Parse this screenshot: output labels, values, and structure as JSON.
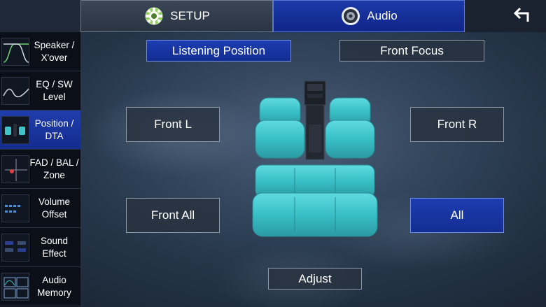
{
  "header": {
    "tabs": [
      {
        "label": "SETUP",
        "icon": "gear-icon",
        "active": false
      },
      {
        "label": "Audio",
        "icon": "speaker-icon",
        "active": true
      }
    ],
    "back_icon": "back-arrow-icon"
  },
  "sidebar": {
    "items": [
      {
        "label": "Speaker /\nX'over",
        "icon": "speaker-xover-thumbnail-icon",
        "active": false
      },
      {
        "label": "EQ / SW\nLevel",
        "icon": "eq-thumbnail-icon",
        "active": false
      },
      {
        "label": "Position /\nDTA",
        "icon": "position-thumbnail-icon",
        "active": true
      },
      {
        "label": "FAD / BAL /\nZone",
        "icon": "fader-balance-thumbnail-icon",
        "active": false
      },
      {
        "label": "Volume\nOffset",
        "icon": "volume-offset-thumbnail-icon",
        "active": false
      },
      {
        "label": "Sound\nEffect",
        "icon": "sound-effect-thumbnail-icon",
        "active": false
      },
      {
        "label": "Audio\nMemory",
        "icon": "audio-memory-thumbnail-icon",
        "active": false
      }
    ]
  },
  "main": {
    "mode_buttons": {
      "listening_position": "Listening Position",
      "front_focus": "Front Focus",
      "selected": "Listening Position"
    },
    "positions": {
      "front_l": "Front L",
      "front_r": "Front R",
      "front_all": "Front All",
      "all": "All",
      "selected": "All"
    },
    "adjust_label": "Adjust",
    "seat_illustration": "car-seats-illustration"
  },
  "colors": {
    "accent": "#1a37a6",
    "seat": "#3fc4c9",
    "sidebar_bg": "#0b0f17",
    "button_border": "#8d98a6"
  }
}
